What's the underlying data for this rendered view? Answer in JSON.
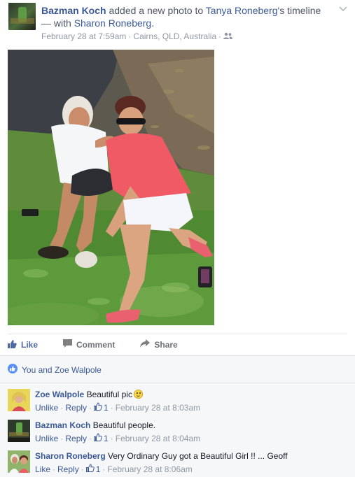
{
  "post": {
    "author": "Bazman Koch",
    "action_text": " added a new photo to ",
    "target": "Tanya Roneberg",
    "target_suffix": "'s timeline",
    "with_prefix": "— with ",
    "tagged": "Sharon Roneberg",
    "with_suffix": ".",
    "timestamp": "February 28 at 7:59am",
    "separator": "·",
    "location": "Cairns, QLD, Australia",
    "audience_icon": "friends-icon",
    "menu_icon": "chevron-down-icon"
  },
  "actions": {
    "like": "Like",
    "comment": "Comment",
    "share": "Share"
  },
  "likes": {
    "text": "You and Zoe Walpole",
    "icon": "like-badge-icon"
  },
  "comments": [
    {
      "author": "Zoe Walpole",
      "text": "Beautiful pic",
      "has_emoji": true,
      "primary_action": "Unlike",
      "reply": "Reply",
      "like_count": "1",
      "time": "February 28 at 8:03am"
    },
    {
      "author": "Bazman Koch",
      "text": "Beautiful people.",
      "has_emoji": false,
      "primary_action": "Unlike",
      "reply": "Reply",
      "like_count": "1",
      "time": "February 28 at 8:04am"
    },
    {
      "author": "Sharon Roneberg",
      "text": "Very Ordinary Guy got a Beautiful Girl !! ... Geoff",
      "has_emoji": false,
      "primary_action": "Like",
      "reply": "Reply",
      "like_count": "1",
      "time": "February 28 at 8:06am"
    }
  ],
  "colors": {
    "link": "#3b5998",
    "muted": "#9197a3",
    "feedback_bg": "#f6f7f9",
    "like_blue": "#4e69a2"
  }
}
